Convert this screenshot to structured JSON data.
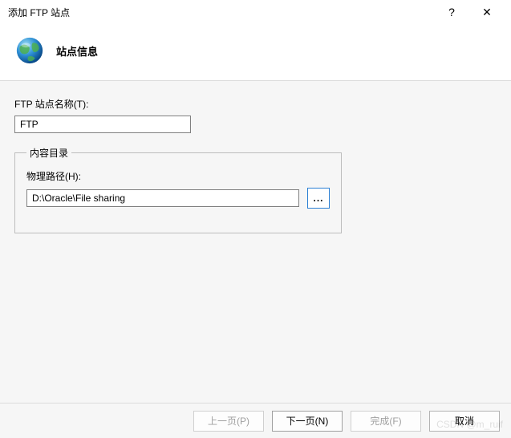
{
  "window": {
    "title": "添加 FTP 站点",
    "help_symbol": "?",
    "close_symbol": "✕"
  },
  "header": {
    "title": "站点信息"
  },
  "form": {
    "site_name_label": "FTP 站点名称(T):",
    "site_name_value": "FTP",
    "content_dir_legend": "内容目录",
    "path_label": "物理路径(H):",
    "path_value": "D:\\Oracle\\File sharing",
    "browse_label": "..."
  },
  "footer": {
    "prev": "上一页(P)",
    "next": "下一页(N)",
    "finish": "完成(F)",
    "cancel": "取消"
  },
  "watermark": "CSDN @m_ruif"
}
